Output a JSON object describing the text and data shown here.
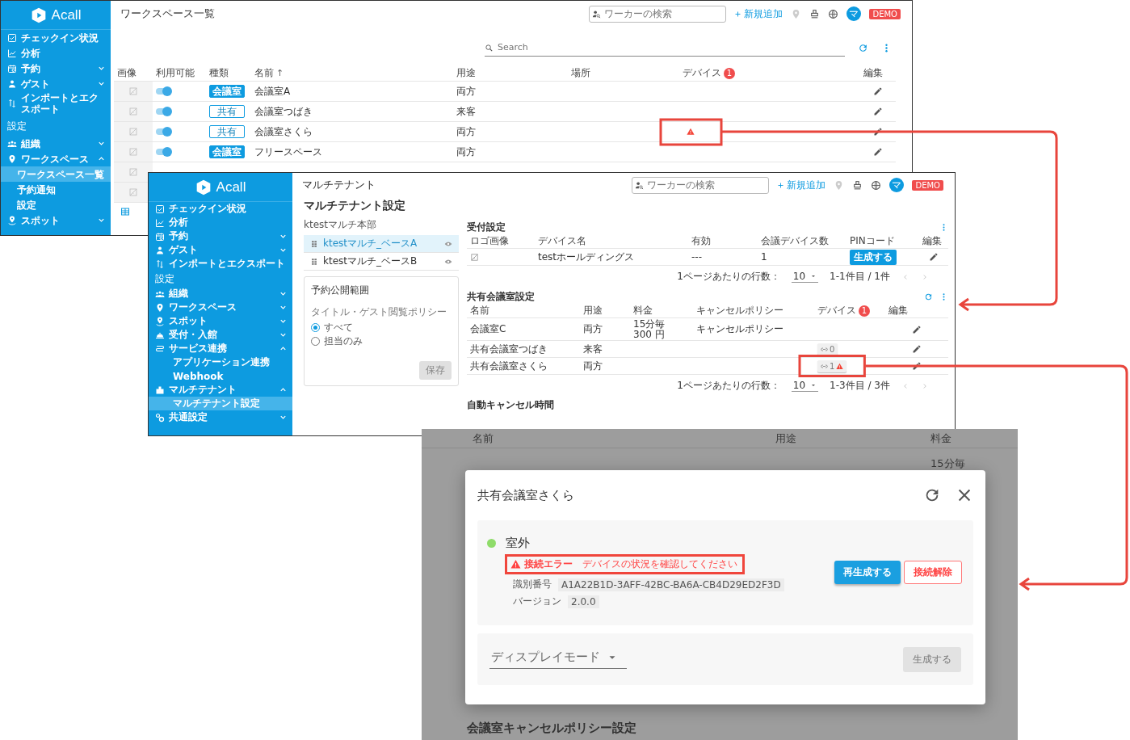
{
  "workspace_list_screen": {
    "sidebar": {
      "logo": "Acall",
      "items": [
        {
          "kind": "item",
          "label": "チェックイン状況",
          "selected": false
        },
        {
          "kind": "item",
          "label": "分析",
          "selected": false
        },
        {
          "kind": "item",
          "label": "予約",
          "expanded": false,
          "selected": false
        },
        {
          "kind": "item",
          "label": "ゲスト",
          "expanded": false,
          "selected": false
        },
        {
          "kind": "item",
          "label": "インポートとエクスポート",
          "selected": false
        },
        {
          "kind": "section",
          "label": "設定"
        },
        {
          "kind": "item",
          "label": "組織",
          "expanded": false,
          "selected": false
        },
        {
          "kind": "item",
          "label": "ワークスペース",
          "expanded": true,
          "selected": false
        },
        {
          "kind": "subitem",
          "label": "ワークスペース一覧",
          "selected": true
        },
        {
          "kind": "subitem",
          "label": "予約通知",
          "selected": false
        },
        {
          "kind": "subitem",
          "label": "設定",
          "selected": false
        },
        {
          "kind": "item",
          "label": "スポット",
          "expanded": false,
          "selected": false
        }
      ]
    },
    "header": {
      "title": "ワークスペース一覧",
      "search_placeholder": "ワーカーの検索",
      "add_label": "新規追加",
      "avatar": "マ",
      "badge": "DEMO"
    },
    "search": {
      "placeholder": "Search"
    },
    "table": {
      "columns": [
        {
          "label": "画像"
        },
        {
          "label": "利用可能"
        },
        {
          "label": "種類"
        },
        {
          "label": "名前",
          "sort_mark": "↑"
        },
        {
          "label": "用途"
        },
        {
          "label": "場所"
        },
        {
          "label": "デバイス",
          "count": "1"
        },
        {
          "label": "編集"
        }
      ],
      "rows": [
        {
          "kind": "row",
          "available": true,
          "type": "会議室",
          "filled": true,
          "name": "会議室A",
          "usage": "両方",
          "device_error": false
        },
        {
          "kind": "row",
          "available": true,
          "type": "共有",
          "filled": false,
          "name": "会議室つばき",
          "usage": "来客",
          "device_error": false
        },
        {
          "kind": "row",
          "available": true,
          "type": "共有",
          "filled": false,
          "name": "会議室さくら",
          "usage": "両方",
          "device_error": true
        },
        {
          "kind": "row",
          "available": true,
          "type": "会議室",
          "filled": true,
          "name": "フリースペース",
          "usage": "両方",
          "device_error": false
        },
        {
          "kind": "covered"
        },
        {
          "kind": "covered"
        }
      ]
    }
  },
  "multitenant_screen": {
    "sidebar": {
      "logo": "Acall",
      "items": [
        {
          "kind": "item",
          "label": "チェックイン状況",
          "selected": false
        },
        {
          "kind": "item",
          "label": "分析",
          "selected": false
        },
        {
          "kind": "item",
          "label": "予約",
          "expanded": false,
          "selected": false
        },
        {
          "kind": "item",
          "label": "ゲスト",
          "expanded": false,
          "selected": false
        },
        {
          "kind": "item",
          "label": "インポートとエクスポート",
          "selected": false
        },
        {
          "kind": "section",
          "label": "設定"
        },
        {
          "kind": "item",
          "label": "組織",
          "expanded": false,
          "selected": false
        },
        {
          "kind": "item",
          "label": "ワークスペース",
          "expanded": false,
          "selected": false
        },
        {
          "kind": "item",
          "label": "スポット",
          "expanded": false,
          "selected": false
        },
        {
          "kind": "item",
          "label": "受付・入館",
          "expanded": false,
          "selected": false
        },
        {
          "kind": "item",
          "label": "サービス連携",
          "expanded": true,
          "selected": false
        },
        {
          "kind": "subitem",
          "label": "アプリケーション連携",
          "selected": false
        },
        {
          "kind": "subitem",
          "label": "Webhook",
          "selected": false
        },
        {
          "kind": "item",
          "label": "マルチテナント",
          "expanded": true,
          "selected": false
        },
        {
          "kind": "subitem",
          "label": "マルチテナント設定",
          "selected": true
        },
        {
          "kind": "item",
          "label": "共通設定",
          "expanded": false,
          "selected": false
        }
      ]
    },
    "header": {
      "title": "マルチテナント",
      "search_placeholder": "ワーカーの検索",
      "add_label": "新規追加",
      "avatar": "マ",
      "badge": "DEMO"
    },
    "heading": "マルチテナント設定",
    "tenant_group": {
      "label": "ktestマルチ本部",
      "bases": [
        {
          "name": "ktestマルチ_ベースA",
          "selected": true
        },
        {
          "name": "ktestマルチ_ベースB",
          "selected": false
        }
      ]
    },
    "policy_card": {
      "title": "予約公開範囲",
      "field_label": "タイトル・ゲスト閲覧ポリシー",
      "options": [
        {
          "label": "すべて",
          "selected": true
        },
        {
          "label": "担当のみ",
          "selected": false
        }
      ],
      "save": {
        "label": "保存",
        "disabled": true
      }
    },
    "reception": {
      "title": "受付設定",
      "columns": [
        {
          "label": "ロゴ画像"
        },
        {
          "label": "デバイス名"
        },
        {
          "label": "有効"
        },
        {
          "label": "会議デバイス数"
        },
        {
          "label": "PINコード"
        },
        {
          "label": "編集"
        }
      ],
      "rows": [
        {
          "name": "testホールディングス",
          "enabled": "---",
          "device_count": "1",
          "pin_button": "生成する"
        }
      ],
      "pagination": {
        "rows_label": "1ページあたりの行数：",
        "per_page": "10",
        "range": "1-1件目 / 1件"
      }
    },
    "shared_rooms": {
      "title": "共有会議室設定",
      "columns": [
        {
          "label": "名前"
        },
        {
          "label": "用途"
        },
        {
          "label": "料金"
        },
        {
          "label": "キャンセルポリシー"
        },
        {
          "label": "デバイス",
          "count": "1"
        },
        {
          "label": "編集"
        }
      ],
      "rows": [
        {
          "name": "会議室C",
          "usage": "両方",
          "fee": [
            "15分毎",
            "300 円"
          ],
          "cancel_policy": "キャンセルポリシー"
        },
        {
          "name": "共有会議室つばき",
          "usage": "来客",
          "devices": {
            "count": "0",
            "error": false
          }
        },
        {
          "name": "共有会議室さくら",
          "usage": "両方",
          "devices": {
            "count": "1",
            "error": true
          }
        }
      ],
      "pagination": {
        "rows_label": "1ページあたりの行数：",
        "per_page": "10",
        "range": "1-3件目 / 3件"
      }
    },
    "auto_cancel": {
      "title": "自動キャンセル時間"
    }
  },
  "device_dialog_screen": {
    "backdrop": {
      "columns": [
        "名前",
        "用途",
        "料金"
      ],
      "fee": "15分毎",
      "section_title": "会議室キャンセルポリシー設定"
    },
    "dialog": {
      "title": "共有会議室さくら",
      "device": {
        "name": "室外",
        "error_message": "**接続エラー**　デバイスの状況を確認してください",
        "id_label": "識別番号",
        "id": "A1A22B1D-3AFF-42BC-BA6A-CB4D29ED2F3D",
        "version_label": "バージョン",
        "version": "2.0.0",
        "regenerate": "再生成する",
        "disconnect": "接続解除"
      },
      "display_mode": {
        "placeholder": "ディスプレイモード"
      },
      "generate": {
        "label": "生成する",
        "disabled": true
      }
    }
  }
}
